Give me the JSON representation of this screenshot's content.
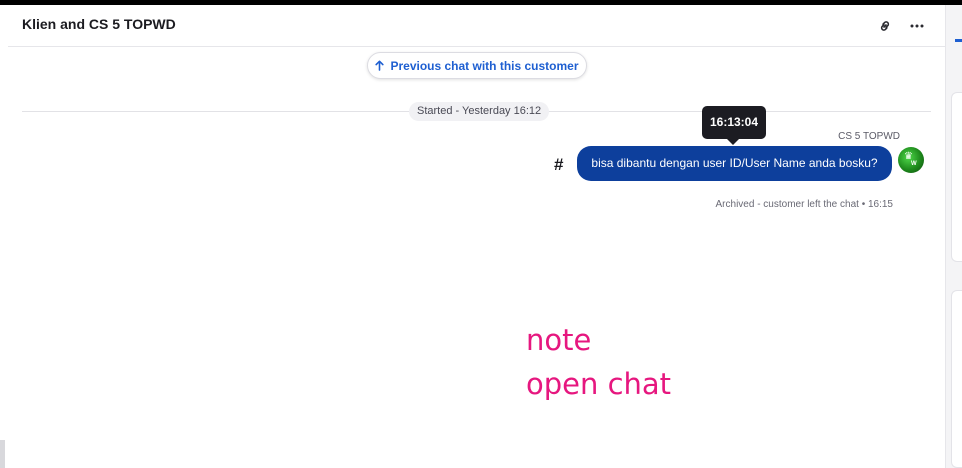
{
  "header": {
    "title": "Klien and CS 5 TOPWD",
    "link_icon": "link-icon",
    "more_icon": "more-icon"
  },
  "history": {
    "previous_chat_label": "Previous chat with this customer",
    "arrow_icon": "arrow-up-icon"
  },
  "session": {
    "started_label": "Started - Yesterday 16:12"
  },
  "message": {
    "tooltip_time": "16:13:04",
    "author": "CS 5 TOPWD",
    "text": "bisa dibantu dengan user ID/User Name anda bosku?",
    "hash_label": "#",
    "status": "Archived - customer left the chat • 16:15",
    "avatar_icon": "agent-avatar"
  },
  "annotation": {
    "line1": "note",
    "line2": "open chat",
    "color": "#e6177f"
  },
  "colors": {
    "accent": "#1e5fd1",
    "bubble": "#0d3f9c",
    "tooltip": "#1c1c22"
  }
}
